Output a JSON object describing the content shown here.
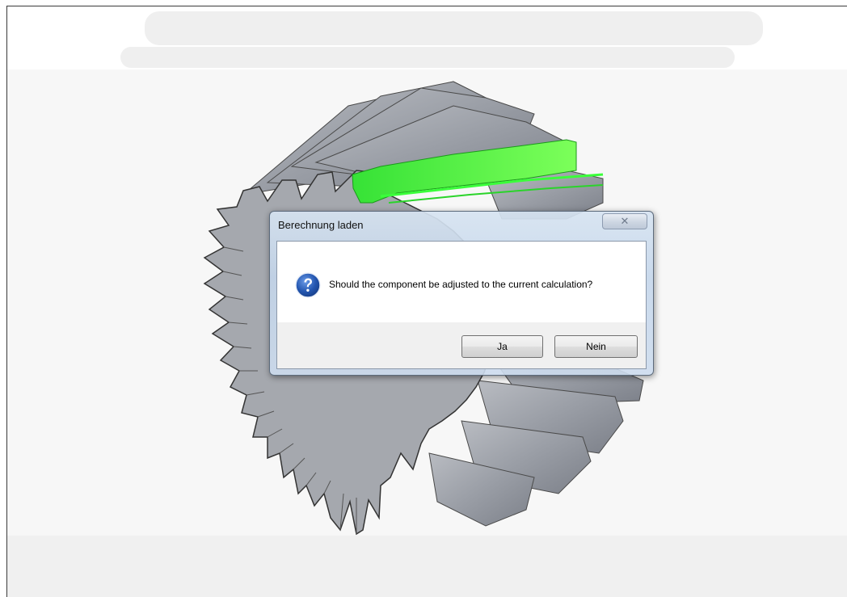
{
  "dialog": {
    "title": "Berechnung laden",
    "close_glyph": "✕",
    "message": "Should the component be adjusted to the current calculation?",
    "icon": "question-icon",
    "buttons": {
      "yes_label": "Ja",
      "no_label": "Nein"
    }
  },
  "colors": {
    "highlight": "#2fe02f",
    "gear_face": "#a3a6ac",
    "gear_outline": "#3c3c3c",
    "dialog_frame": "#c9daee",
    "icon_blue": "#2356b0"
  }
}
